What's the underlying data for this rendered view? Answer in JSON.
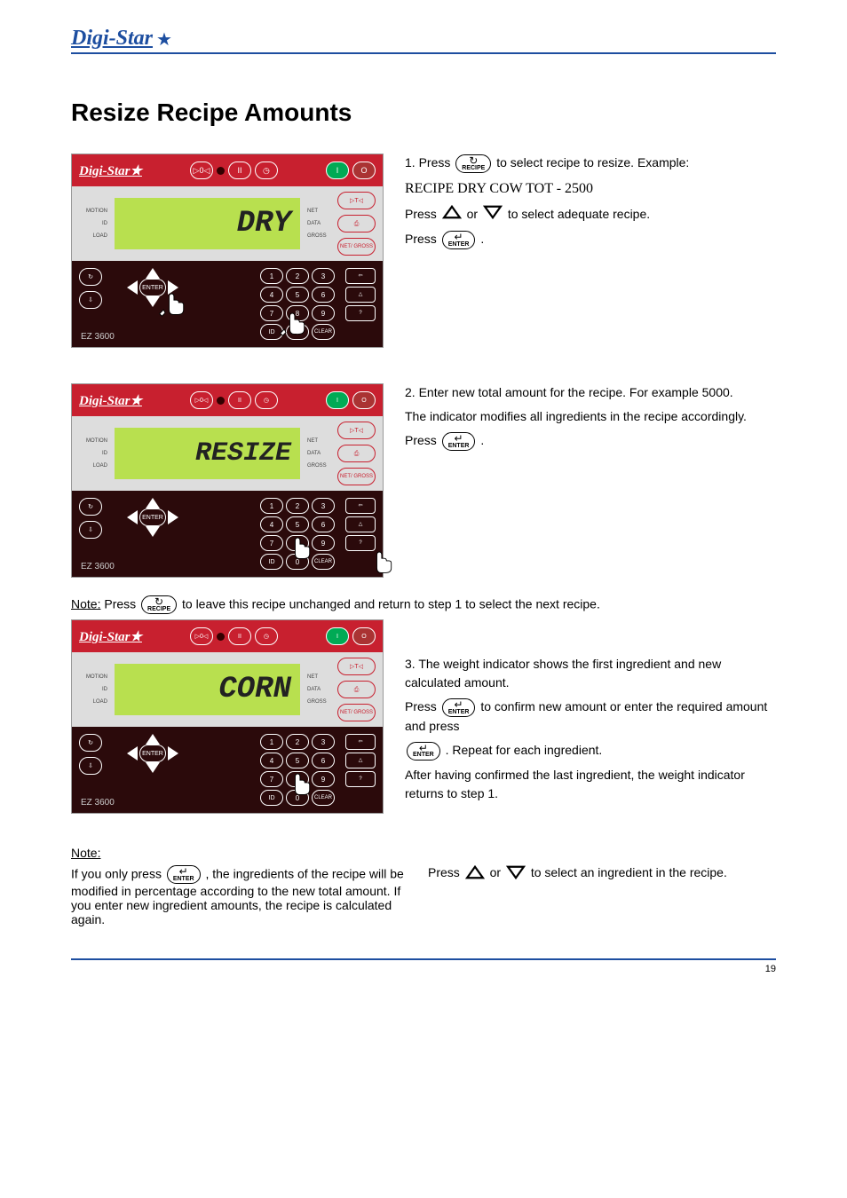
{
  "header": {
    "logo": "Digi-Star"
  },
  "title": "Resize Recipe Amounts",
  "footer": {
    "pagenum": "19"
  },
  "icons": {
    "recipe_glyph": "↻",
    "recipe_label": "RECIPE",
    "enter_glyph": "↵",
    "enter_label": "ENTER",
    "pens_glyph": "⇩",
    "pens_label": "PENS",
    "tare_glyph": "▷T◁",
    "tare_label": "TARE",
    "print_glyph": "⎙",
    "print_label": "PRINT",
    "netgross_label": "NET/\nGROSS",
    "zero_glyph": "▷0◁",
    "zero_label": "ZERO",
    "hold_glyph": "II",
    "hold_label": "HOLD",
    "timer_glyph": "◷",
    "timer_label": "TIMER/\nCOUNTER",
    "on_glyph": "I",
    "on_label": "ON",
    "off_glyph": "O",
    "off_label": "OFF",
    "function_glyph": "⇦",
    "function_label": "FUNCTION",
    "select_glyph": "△",
    "select_label": "SELECT",
    "help_glyph": "?",
    "help_label": "HELP"
  },
  "device": {
    "logo": "Digi-Star",
    "model": "EZ 3600",
    "annun_left": [
      "MOTION",
      "ID",
      "LOAD"
    ],
    "annun_right": [
      "NET",
      "GROSS"
    ],
    "annun_mid": [
      "DATA"
    ],
    "numpad": [
      "1",
      "2",
      "3",
      "4",
      "5",
      "6",
      "7",
      "8",
      "9",
      "ID",
      "0",
      "CLEAR"
    ]
  },
  "step1": {
    "lcd": "DRY",
    "bullet": "1.",
    "l1_a": "Press ",
    "l1_b": " to select recipe to resize. Example:",
    "recipe_line": "RECIPE DRY COW TOT - 2500",
    "l2_a": "Press ",
    "l2_b": " or ",
    "l2_c": " to select adequate recipe.",
    "l3_a": "Press ",
    "l3_b": "."
  },
  "step2": {
    "lcd": "RESIZE",
    "bullet": "2.",
    "l1": "Enter new total amount for the recipe. For example 5000.",
    "l2": "The indicator modifies all ingredients in the recipe accordingly.",
    "l3_a": "Press ",
    "l3_b": "."
  },
  "step3": {
    "lcd": "CORN",
    "note_label": "Note:",
    "note_text_a": " Press ",
    "note_text_b": " to leave this recipe unchanged and return to step 1 to select the next recipe.",
    "bullet": "3.",
    "l1": "The weight indicator shows the first ingredient and new calculated amount.",
    "l2_a": "Press ",
    "l2_b": " to confirm new amount or enter the required amount and press",
    "l3": ". Repeat for each ingredient.",
    "l4": "After having confirmed the last ingredient, the weight indicator returns to step 1."
  },
  "notes": {
    "label": "Note:",
    "n1_a": "If you only press ",
    "n1_b": " , the ingredients of the recipe will be modified in percentage according to the new total amount. If you enter new ingredient amounts, the recipe is calculated again.",
    "n2_a": "Press ",
    "n2_b": " or ",
    "n2_c": " to select an ingredient in the recipe."
  }
}
